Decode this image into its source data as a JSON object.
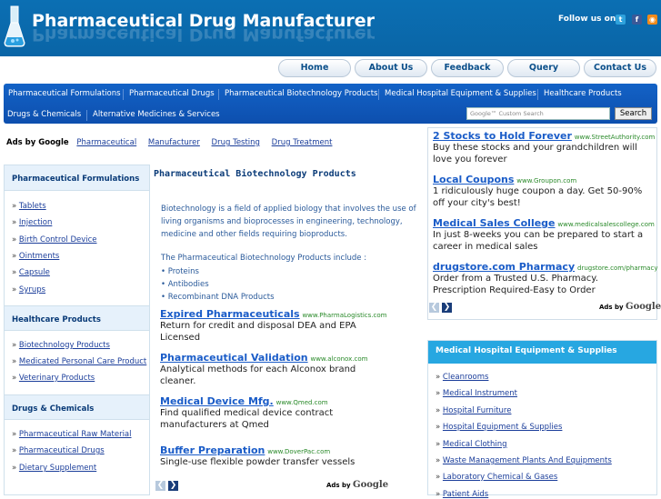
{
  "header": {
    "title": "Pharmaceutical Drug Manufacturer",
    "follow_label": "Follow us on :",
    "social_icons": [
      "twitter-icon",
      "facebook-icon",
      "rss-icon"
    ]
  },
  "topnav": [
    "Home",
    "About Us",
    "Feedback",
    "Query",
    "Contact Us"
  ],
  "catnav": {
    "row1": [
      "Pharmaceutical Formulations",
      "Pharmaceutical Drugs",
      "Pharmaceutical Biotechnology Products",
      "Medical Hospital Equipment & Supplies",
      "Healthcare Products"
    ],
    "row2": [
      "Drugs & Chemicals",
      "Alternative Medicines & Services"
    ]
  },
  "search": {
    "placeholder": "Google™ Custom Search",
    "button": "Search"
  },
  "adlinks": {
    "label": "Ads by Google",
    "links": [
      "Pharmaceutical",
      "Manufacturer",
      "Drug Testing",
      "Drug Treatment"
    ]
  },
  "sidebar": {
    "sections": [
      {
        "title": "Pharmaceutical Formulations",
        "items": [
          "Tablets",
          "Injection",
          "Birth Control Device",
          "Ointments",
          "Capsule",
          "Syrups"
        ]
      },
      {
        "title": "Healthcare Products",
        "items": [
          "Biotechnology Products",
          "Medicated Personal Care Product",
          "Veterinary Products"
        ]
      },
      {
        "title": "Drugs & Chemicals",
        "items": [
          "Pharmaceutical Raw Material",
          "Pharmaceutical Drugs",
          "Dietary Supplement"
        ]
      }
    ]
  },
  "main": {
    "title": "Pharmaceutical Biotechnology Products",
    "intro": "Biotechnology is a field of applied biology that involves the use of living organisms and bioprocesses in engineering, technology, medicine and other fields requiring bioproducts.",
    "include_heading": "The Pharmaceutical Biotechnology Products include :",
    "bullets": [
      "• Proteins",
      "• Antibodies",
      "• Recombinant DNA Products"
    ],
    "ads": [
      {
        "title": "Expired Pharmaceuticals",
        "url": "www.PharmaLogistics.com",
        "body": "Return for credit and disposal DEA and EPA Licensed"
      },
      {
        "title": "Pharmaceutical Validation",
        "url": "www.alconox.com",
        "body": "Analytical methods for each Alconox brand cleaner."
      },
      {
        "title": "Medical Device Mfg.",
        "url": "www.Qmed.com",
        "body": "Find qualified medical device contract manufacturers at Qmed"
      },
      {
        "title": "Buffer Preparation",
        "url": "www.DoverPac.com",
        "body": "Single-use flexible powder transfer vessels"
      }
    ],
    "ads_by": "Ads by",
    "ads_google": "Google"
  },
  "right": {
    "ads": [
      {
        "title": "2 Stocks to Hold Forever",
        "url": "www.StreetAuthority.com",
        "body": "Buy these stocks and your grandchildren will love you forever"
      },
      {
        "title": "Local Coupons",
        "url": "www.Groupon.com",
        "body": "1 ridiculously huge coupon a day. Get 50-90% off your city's best!"
      },
      {
        "title": "Medical Sales College",
        "url": "www.medicalsalescollege.com",
        "body": "In just 8-weeks you can be prepared to start a career in medical sales"
      },
      {
        "title": "drugstore.com Pharmacy",
        "url": "drugstore.com/pharmacy",
        "body": "Order from a Trusted U.S. Pharmacy. Prescription Required-Easy to Order"
      }
    ],
    "box_title": "Medical Hospital Equipment & Supplies",
    "box_items": [
      "Cleanrooms",
      "Medical Instrument",
      "Hospital Furniture",
      "Hospital Equipment & Supplies",
      "Medical Clothing",
      "Waste Management Plants And Equipments",
      "Laboratory Chemical & Gases",
      "Patient Aids"
    ]
  },
  "colors": {
    "header_blue": "#0a68ab",
    "nav_blue": "#1262c4",
    "accent_cyan": "#27a7e1"
  }
}
